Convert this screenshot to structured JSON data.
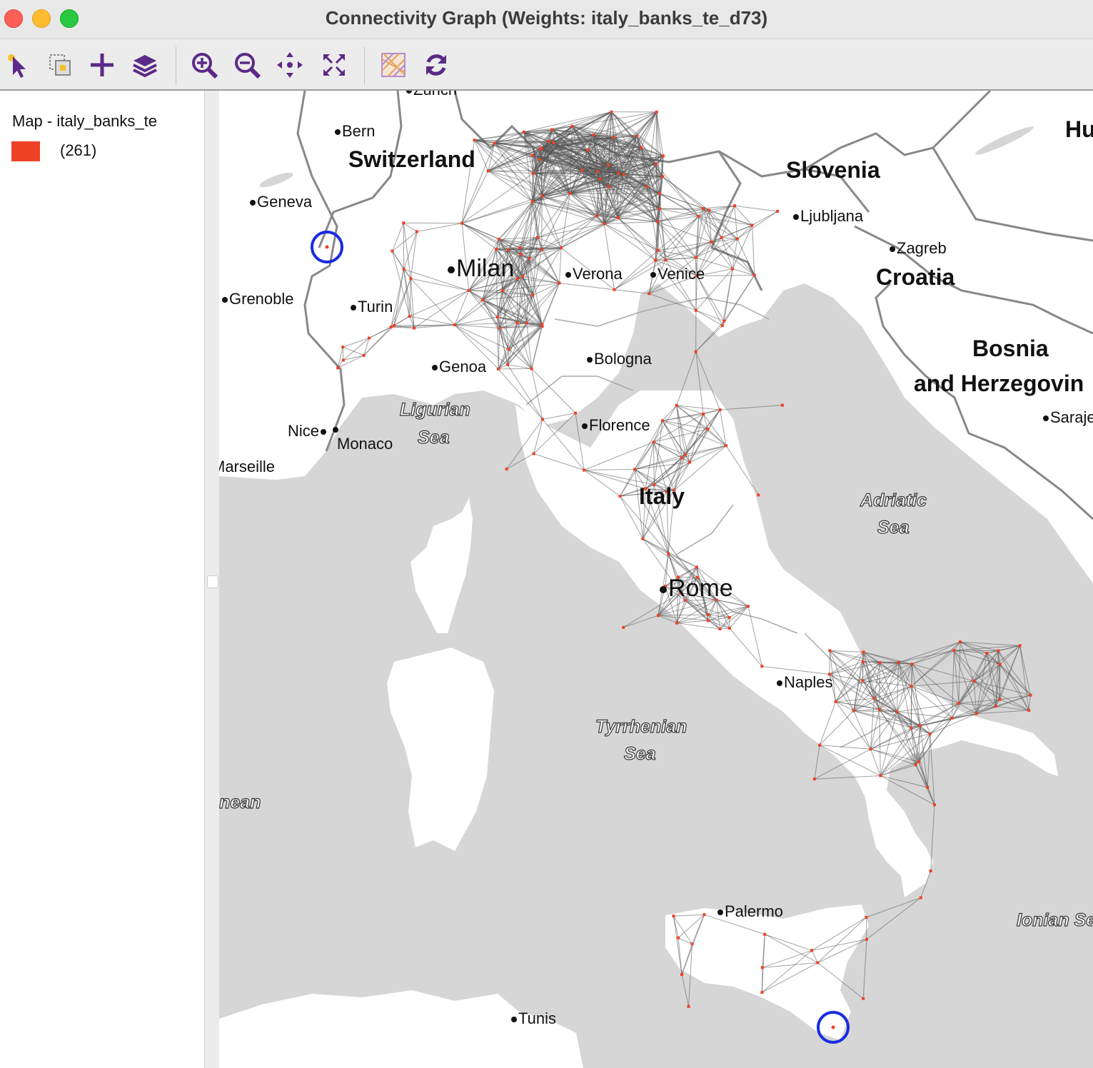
{
  "window": {
    "title": "Connectivity Graph (Weights: italy_banks_te_d73)"
  },
  "toolbar": {
    "buttons": [
      {
        "name": "select-tool",
        "icon": "pointer-icon"
      },
      {
        "name": "selection-options",
        "icon": "select-options-icon"
      },
      {
        "name": "add-layer",
        "icon": "plus-icon"
      },
      {
        "name": "layers",
        "icon": "layers-icon"
      },
      {
        "name": "zoom-in",
        "icon": "zoom-in-icon"
      },
      {
        "name": "zoom-out",
        "icon": "zoom-out-icon"
      },
      {
        "name": "pan",
        "icon": "pan-icon"
      },
      {
        "name": "full-extent",
        "icon": "full-extent-icon"
      },
      {
        "name": "basemap",
        "icon": "basemap-icon"
      },
      {
        "name": "refresh",
        "icon": "refresh-icon"
      }
    ]
  },
  "legend": {
    "title": "Map - italy_banks_te",
    "items": [
      {
        "color": "#ef4126",
        "label": "(261)"
      }
    ]
  },
  "map": {
    "countries": [
      "Switzerland",
      "Slovenia",
      "Croatia",
      "Bosnia",
      "and Herzegovin",
      "Italy",
      "Hu"
    ],
    "seas": [
      "Ligurian",
      "Sea",
      "Adriatic",
      "Sea",
      "Tyrrhenian",
      "Sea",
      "Ionian Se",
      "nean"
    ],
    "cities": [
      "Zurich",
      "Bern",
      "Geneva",
      "Grenoble",
      "Turin",
      "Genoa",
      "Nice",
      "Monaco",
      "Marseille",
      "Ljubljana",
      "Zagreb",
      "Venice",
      "Verona",
      "Bologna",
      "Florence",
      "Naples",
      "Palermo",
      "Tunis",
      "Saraje"
    ],
    "major_cities": [
      "Milan",
      "Rome"
    ],
    "colors": {
      "node": "#ef4126",
      "edge": "#555555",
      "highlight": "#1a2de0",
      "land": "#ffffff",
      "sea": "#d6d6d6"
    }
  }
}
